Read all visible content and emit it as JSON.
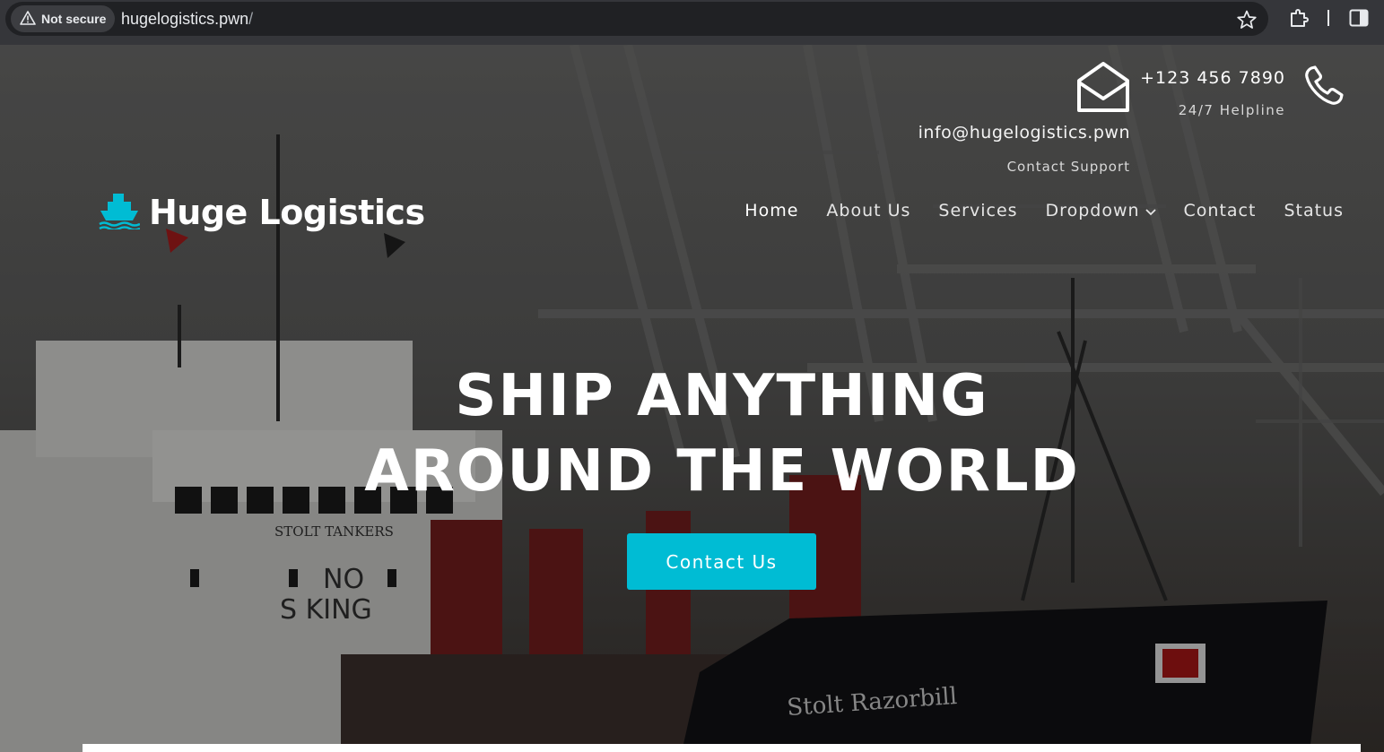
{
  "browser": {
    "security_label": "Not secure",
    "url_host": "hugelogistics.pwn",
    "url_path": "/",
    "icons": [
      "warning-icon",
      "star-icon",
      "extensions-icon",
      "side-panel-icon"
    ]
  },
  "contact": {
    "email": "info@hugelogistics.pwn",
    "email_caption": "Contact Support",
    "phone": "+123 456 7890",
    "phone_caption": "24/7 Helpline"
  },
  "brand": {
    "name": "Huge Logistics",
    "accent": "#00bcd4"
  },
  "nav": {
    "items": [
      {
        "label": "Home",
        "active": true
      },
      {
        "label": "About Us",
        "active": false
      },
      {
        "label": "Services",
        "active": false
      },
      {
        "label": "Dropdown",
        "active": false,
        "has_dropdown": true
      },
      {
        "label": "Contact",
        "active": false
      },
      {
        "label": "Status",
        "active": false
      }
    ]
  },
  "hero": {
    "headline_line1": "SHIP ANYTHING",
    "headline_line2": "AROUND THE WORLD",
    "cta_label": "Contact Us"
  }
}
